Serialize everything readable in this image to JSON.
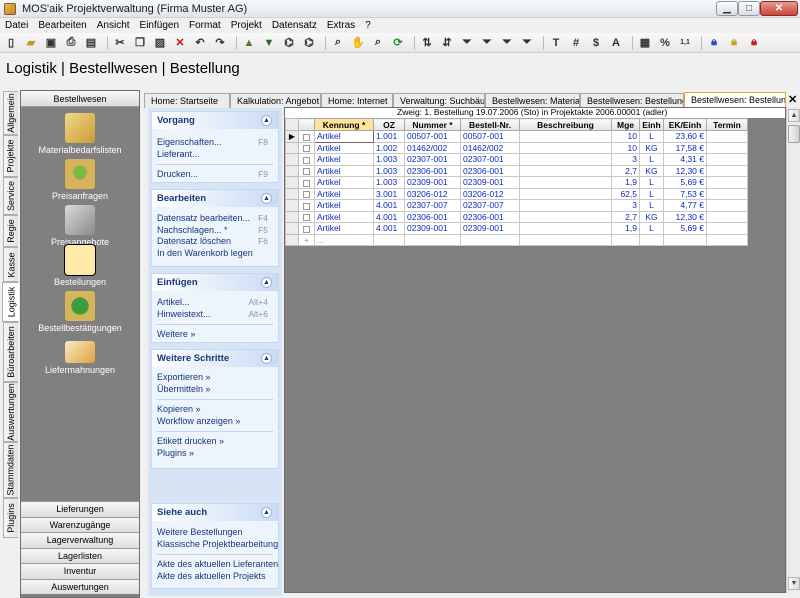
{
  "window": {
    "title": "MOS'aik Projektverwaltung (Firma Muster AG)"
  },
  "menu": [
    "Datei",
    "Bearbeiten",
    "Ansicht",
    "Einfügen",
    "Format",
    "Projekt",
    "Datensatz",
    "Extras",
    "?"
  ],
  "page_title": "Logistik | Bestellwesen | Bestellung",
  "vertical_tabs": [
    "Allgemein",
    "Projekte",
    "Service",
    "Regie",
    "Kasse",
    "Logistik",
    "Büroarbeiten",
    "Auswertungen",
    "Stammdaten",
    "Plugins"
  ],
  "nav": {
    "header": "Bestellwesen",
    "entries": [
      "Materialbedarfslisten",
      "Preisanfragen",
      "Preisangebote",
      "Bestellungen",
      "Bestellbestätigungen",
      "Liefermahnungen"
    ],
    "bottom": [
      "Lieferungen",
      "Warenzugänge",
      "Lagerverwaltung",
      "Lagerlisten",
      "Inventur",
      "Auswertungen"
    ]
  },
  "taskpane": {
    "groups": [
      {
        "title": "Vorgang",
        "items": [
          [
            "Eigenschaften...",
            "F8"
          ],
          [
            "Lieferant...",
            ""
          ],
          null,
          [
            "Drucken...",
            "F9"
          ]
        ]
      },
      {
        "title": "Bearbeiten",
        "items": [
          [
            "Datensatz bearbeiten...",
            "F4"
          ],
          [
            "Nachschlagen... *",
            "F5"
          ],
          [
            "Datensatz löschen",
            "F6"
          ],
          [
            "In den Warenkorb legen",
            ""
          ]
        ]
      },
      {
        "title": "Einfügen",
        "items": [
          [
            "Artikel...",
            "Alt+4"
          ],
          [
            "Hinweistext...",
            "Alt+6"
          ],
          null,
          [
            "Weitere »",
            ""
          ]
        ]
      },
      {
        "title": "Weitere Schritte",
        "items": [
          [
            "Exportieren »",
            ""
          ],
          [
            "Übermitteln »",
            ""
          ],
          null,
          [
            "Kopieren »",
            ""
          ],
          [
            "Workflow anzeigen »",
            ""
          ],
          null,
          [
            "Etikett drucken »",
            ""
          ],
          [
            "Plugins »",
            ""
          ]
        ]
      },
      {
        "title": "Siehe auch",
        "items": [
          [
            "Weitere Bestellungen",
            ""
          ],
          [
            "Klassische Projektbearbeitung",
            ""
          ],
          null,
          [
            "Akte des aktuellen Lieferanten",
            ""
          ],
          [
            "Akte des aktuellen Projekts",
            ""
          ]
        ]
      }
    ]
  },
  "doc_tabs": [
    "Home: Startseite",
    "Kalkulation: Angebot",
    "Home: Internet",
    "Verwaltung: Suchbäume",
    "Bestellwesen: Materialbe...",
    "Bestellwesen: Bestellungen",
    "Bestellwesen: Bestellung"
  ],
  "info_bar": "Zweig: 1. Bestellung 19.07.2006 (Sto) in Projektakte 2006.00001 (adler)",
  "grid": {
    "columns": [
      "Kennung *",
      "OZ",
      "Nummer *",
      "Bestell-Nr.",
      "Beschreibung",
      "Mge",
      "Einh",
      "EK/Einh",
      "Termin"
    ],
    "rows": [
      [
        "Artikel",
        "1.001",
        "00507-001",
        "00507-001",
        "",
        "10",
        "L",
        "23,60 €",
        ""
      ],
      [
        "Artikel",
        "1.002",
        "01462/002",
        "01462/002",
        "",
        "10",
        "KG",
        "17,58 €",
        ""
      ],
      [
        "Artikel",
        "1.003",
        "02307-001",
        "02307-001",
        "",
        "3",
        "L",
        "4,31 €",
        ""
      ],
      [
        "Artikel",
        "1.003",
        "02306-001",
        "02306-001",
        "",
        "2,7",
        "KG",
        "12,30 €",
        ""
      ],
      [
        "Artikel",
        "1.003",
        "02309-001",
        "02309-001",
        "",
        "1,9",
        "L",
        "5,69 €",
        ""
      ],
      [
        "Artikel",
        "3.001",
        "03206-012",
        "03206-012",
        "",
        "62,5",
        "L",
        "7,53 €",
        ""
      ],
      [
        "Artikel",
        "4.001",
        "02307-007",
        "02307-007",
        "",
        "3",
        "L",
        "4,77 €",
        ""
      ],
      [
        "Artikel",
        "4.001",
        "02306-001",
        "02306-001",
        "",
        "2,7",
        "KG",
        "12,30 €",
        ""
      ],
      [
        "Artikel",
        "4.001",
        "02309-001",
        "02309-001",
        "",
        "1,9",
        "L",
        "5,69 €",
        ""
      ]
    ],
    "new_row_marker": "..."
  },
  "colors": {
    "accent": "#e8a23d",
    "link": "#16387a",
    "cell_text": "#0c2bbf",
    "task_bg": "#d6e4f6",
    "nav_bg": "#808080"
  }
}
